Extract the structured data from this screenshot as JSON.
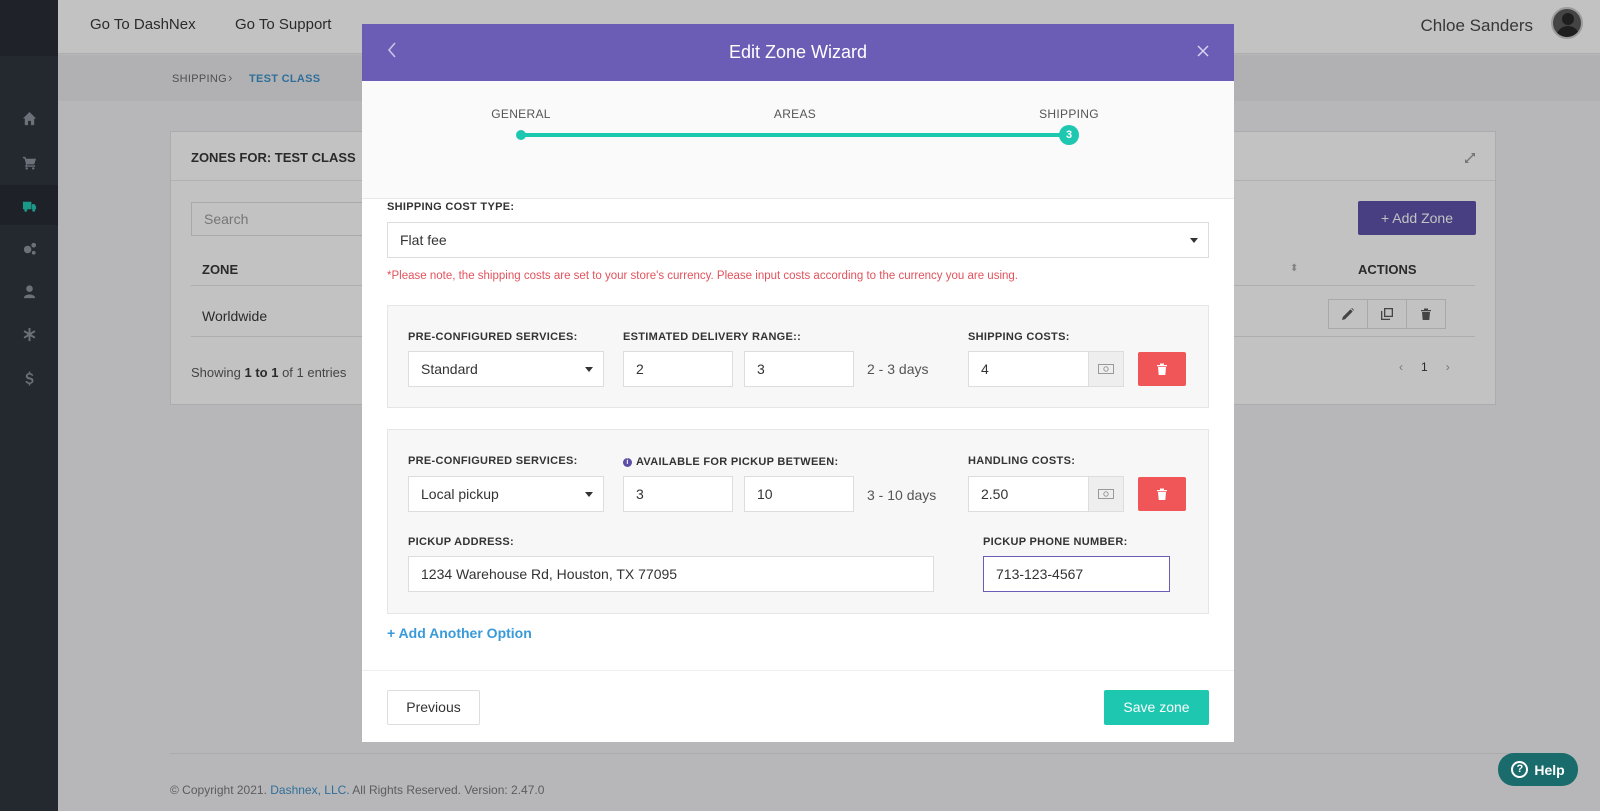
{
  "topbar": {
    "link1": "Go To DashNex",
    "link2": "Go To Support",
    "username": "Chloe Sanders"
  },
  "breadcrumb": {
    "item1": "SHIPPING",
    "item2": "TEST CLASS"
  },
  "card": {
    "title": "ZONES FOR: TEST CLASS",
    "search_placeholder": "Search",
    "add_zone_label": "+ Add Zone",
    "col_zone": "ZONE",
    "col_actions": "ACTIONS",
    "rows": [
      {
        "zone": "Worldwide"
      }
    ],
    "showing_prefix": "Showing ",
    "showing_range": "1 to 1",
    "showing_suffix": " of 1 entries",
    "page": "1"
  },
  "footer": {
    "prefix": "© Copyright 2021. ",
    "link": "Dashnex, LLC.",
    "suffix": " All Rights Reserved. Version: 2.47.0"
  },
  "modal": {
    "title": "Edit Zone Wizard",
    "steps": [
      "GENERAL",
      "AREAS",
      "SHIPPING"
    ],
    "current_step": "3",
    "cost_type_label": "SHIPPING COST TYPE:",
    "cost_type_value": "Flat fee",
    "note": "*Please note, the shipping costs are set to your store's currency. Please input costs according to the currency you are using.",
    "services": [
      {
        "service_label": "PRE-CONFIGURED SERVICES:",
        "service_value": "Standard",
        "range_label": "ESTIMATED DELIVERY RANGE::",
        "range_from": "2",
        "range_to": "3",
        "days_text": "2 - 3 days",
        "cost_label": "SHIPPING COSTS:",
        "cost_value": "4"
      },
      {
        "service_label": "PRE-CONFIGURED SERVICES:",
        "service_value": "Local pickup",
        "range_label": "AVAILABLE FOR PICKUP BETWEEN:",
        "range_from": "3",
        "range_to": "10",
        "days_text": "3 - 10 days",
        "cost_label": "HANDLING COSTS:",
        "cost_value": "2.50",
        "address_label": "PICKUP ADDRESS:",
        "address_value": "1234 Warehouse Rd, Houston, TX 77095",
        "phone_label": "PICKUP PHONE NUMBER:",
        "phone_value": "713-123-4567"
      }
    ],
    "add_option": "+ Add Another Option",
    "previous": "Previous",
    "save": "Save zone"
  },
  "help": {
    "label": "Help"
  },
  "colors": {
    "accent": "#6b5db5",
    "teal": "#1ec7b0",
    "danger": "#f05558",
    "link": "#3a9ad9"
  }
}
